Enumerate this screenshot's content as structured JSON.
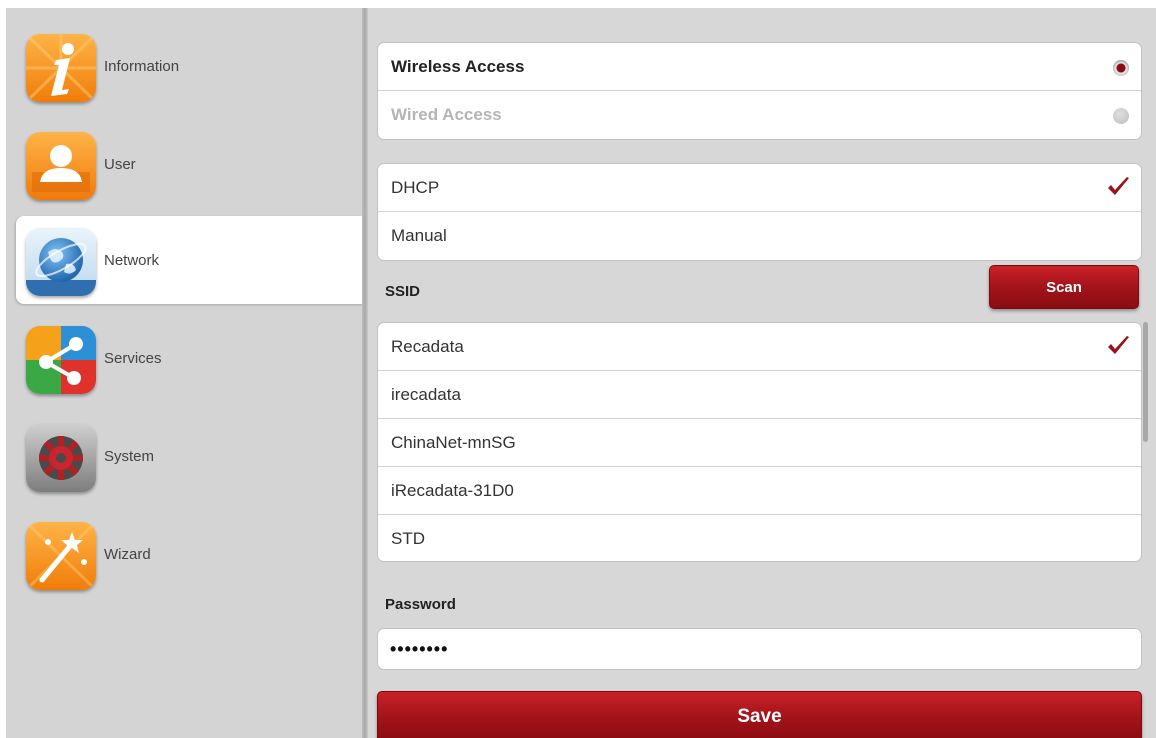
{
  "sidebar": {
    "items": [
      {
        "label": "Information",
        "icon": "info-icon"
      },
      {
        "label": "User",
        "icon": "user-icon"
      },
      {
        "label": "Network",
        "icon": "globe-icon",
        "active": true
      },
      {
        "label": "Services",
        "icon": "share-icon"
      },
      {
        "label": "System",
        "icon": "gear-icon"
      },
      {
        "label": "Wizard",
        "icon": "magic-wand-icon"
      }
    ]
  },
  "access": {
    "wireless_label": "Wireless Access",
    "wired_label": "Wired Access",
    "selected": "Wireless Access"
  },
  "ip_mode": {
    "dhcp_label": "DHCP",
    "manual_label": "Manual",
    "selected": "DHCP"
  },
  "ssid": {
    "label": "SSID",
    "scan_label": "Scan",
    "networks": [
      "Recadata",
      "irecadata",
      "ChinaNet-mnSG",
      "iRecadata-31D0",
      "STD"
    ],
    "selected": "Recadata"
  },
  "password": {
    "label": "Password",
    "value": "••••••••"
  },
  "save_label": "Save",
  "colors": {
    "accent": "#a3131a",
    "check": "#9b1218",
    "sidebar_bg": "#d4d4d4"
  }
}
